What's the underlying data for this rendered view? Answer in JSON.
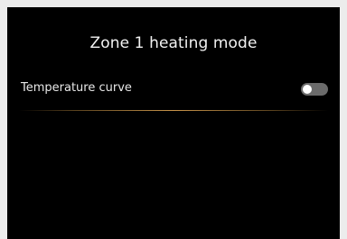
{
  "header": {
    "title": "Zone 1 heating mode"
  },
  "settings": {
    "items": [
      {
        "label": "Temperature curve",
        "toggle_state": "off"
      }
    ]
  },
  "colors": {
    "screen_background": "#000000",
    "divider_accent": "#c8944a",
    "toggle_track_off": "#6b6b6b",
    "toggle_knob": "#ffffff"
  },
  "icons": {
    "toggle": "toggle-switch"
  }
}
